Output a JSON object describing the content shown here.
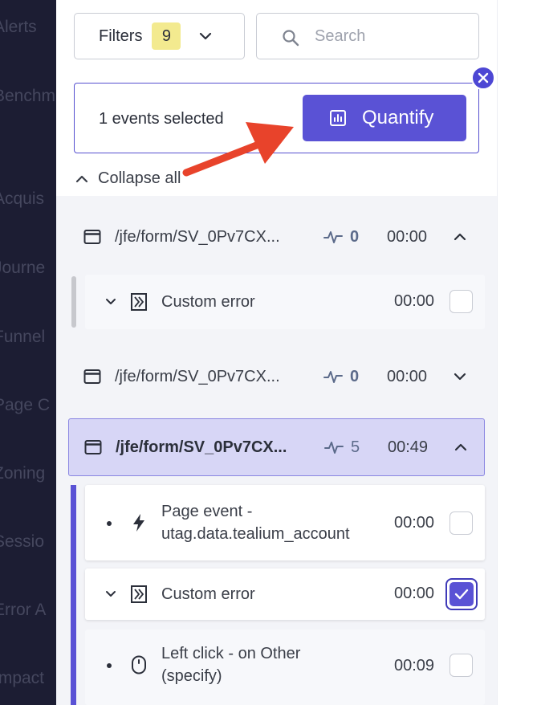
{
  "background_nav": {
    "items": [
      "Alerts",
      "Benchm",
      "Acquis",
      "Journe",
      "Funnel",
      "Page C",
      "Zoning",
      "Sessio",
      "Error A",
      "Impact"
    ]
  },
  "toolbar": {
    "filters_label": "Filters",
    "filters_count": "9",
    "search_placeholder": "Search"
  },
  "selection": {
    "text": "1 events selected",
    "quantify_label": "Quantify"
  },
  "collapse_all_label": "Collapse all",
  "sessions": [
    {
      "url": "/jfe/form/SV_0Pv7CX...",
      "count": "0",
      "time": "00:00",
      "expanded": true,
      "events": [
        {
          "label": "Custom error",
          "time": "00:00",
          "icon": "custom-error-icon",
          "checked": false
        }
      ]
    },
    {
      "url": "/jfe/form/SV_0Pv7CX...",
      "count": "0",
      "time": "00:00",
      "expanded": false,
      "events": []
    },
    {
      "url": "/jfe/form/SV_0Pv7CX...",
      "count": "5",
      "time": "00:49",
      "expanded": true,
      "active": true,
      "events": [
        {
          "label_line1": "Page event -",
          "label_line2": "utag.data.tealium_account",
          "time": "00:00",
          "icon": "lightning-icon",
          "checked": false
        },
        {
          "label": "Custom error",
          "time": "00:00",
          "icon": "custom-error-icon",
          "checked": true
        },
        {
          "label_line1": "Left click - on Other",
          "label_line2": "(specify)",
          "time": "00:09",
          "icon": "mouse-icon",
          "checked": false
        }
      ]
    }
  ],
  "colors": {
    "accent": "#5a52d5",
    "active_row": "#d7d6f6",
    "badge_yellow": "#f3ea8f",
    "annotation_arrow": "#e8432b",
    "sidebar_dark": "#1c1d33"
  }
}
